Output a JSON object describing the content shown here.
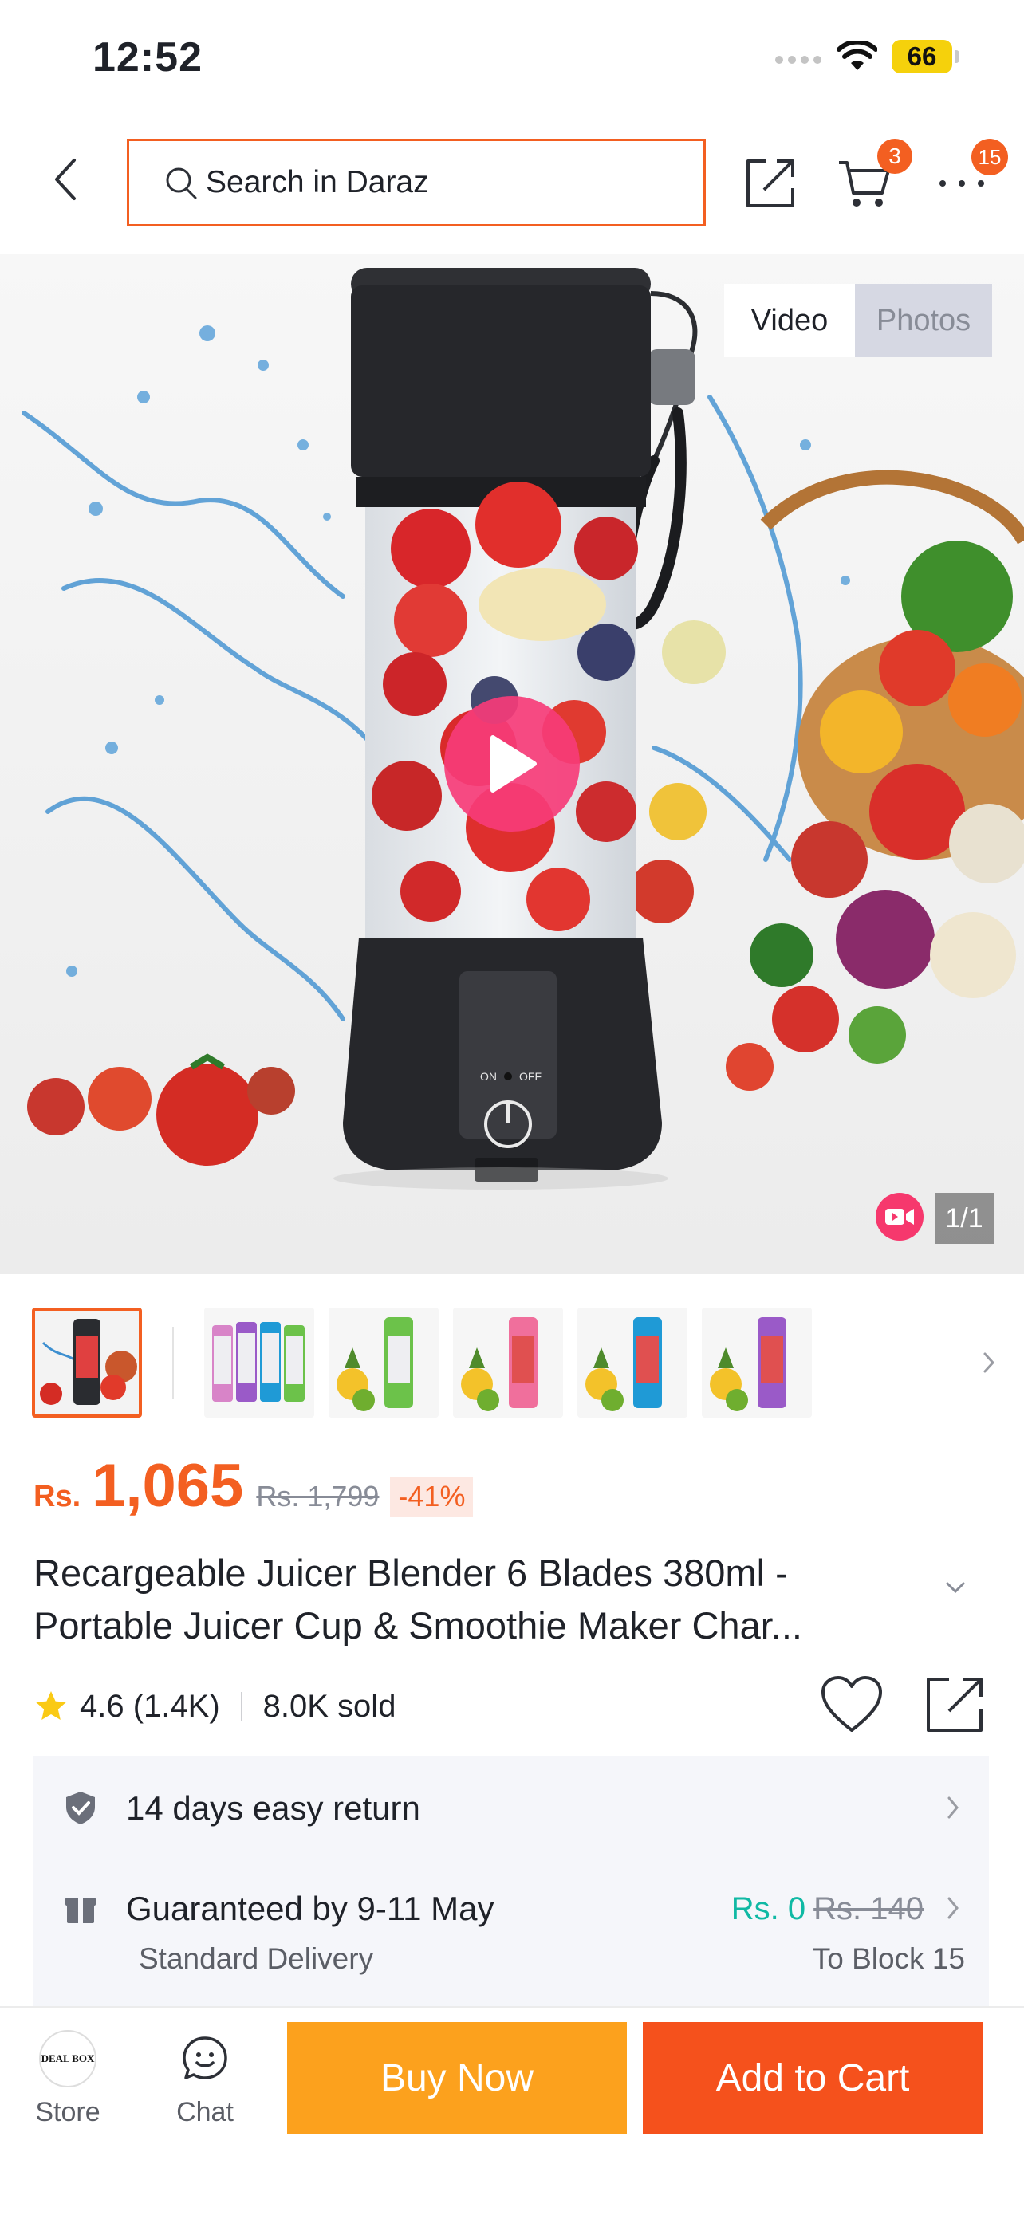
{
  "status_bar": {
    "time": "12:52",
    "battery": "66"
  },
  "nav": {
    "search_placeholder": "Search in Daraz",
    "cart_count": "3",
    "more_count": "15"
  },
  "gallery": {
    "tabs": [
      {
        "label": "Video",
        "active": true
      },
      {
        "label": "Photos",
        "active": false
      }
    ],
    "page_counter": "1/1",
    "device_labels": {
      "on": "ON",
      "off": "OFF"
    },
    "thumbnails": [
      {
        "desc": "black blender",
        "color": "#2a2c30"
      },
      {
        "desc": "four color blenders",
        "color": "#d884c8"
      },
      {
        "desc": "green blender",
        "color": "#6cc24a"
      },
      {
        "desc": "pink blender",
        "color": "#f06f9c"
      },
      {
        "desc": "blue blender",
        "color": "#1f9ad6"
      },
      {
        "desc": "purple blender",
        "color": "#9a5ac8"
      }
    ]
  },
  "product": {
    "currency": "Rs.",
    "price": "1,065",
    "old_price": "Rs. 1,799",
    "discount": "-41%",
    "title_line1": "Recargeable Juicer Blender 6 Blades 380ml -",
    "title_line2": "Portable Juicer Cup & Smoothie Maker Char...",
    "rating": "4.6 (1.4K)",
    "sold": "8.0K sold"
  },
  "services": {
    "return_text": "14 days easy return",
    "delivery_text": "Guaranteed by 9-11 May",
    "delivery_type": "Standard Delivery",
    "fee_free": "Rs. 0",
    "fee_old": "Rs. 140",
    "ship_to": "To Block 15"
  },
  "bottom_bar": {
    "store_label": "Store",
    "store_logo_text": "DEAL BOX",
    "chat_label": "Chat",
    "buy_now": "Buy Now",
    "add_to_cart": "Add to Cart"
  },
  "colors": {
    "brand_orange": "#f35f21",
    "buy_now": "#fca11d",
    "add_to_cart": "#f5511c",
    "free_shipping": "#10b9a4"
  }
}
